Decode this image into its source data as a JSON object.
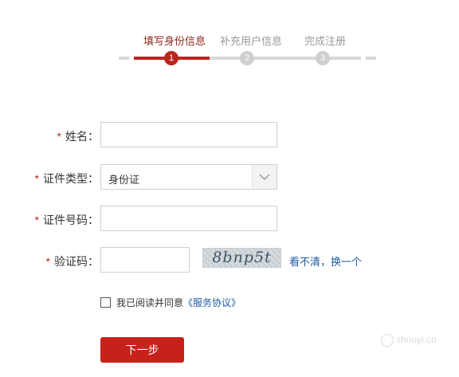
{
  "steps": [
    {
      "label": "填写身份信息",
      "number": "1",
      "active": true
    },
    {
      "label": "补充用户信息",
      "number": "2",
      "active": false
    },
    {
      "label": "完成注册",
      "number": "3",
      "active": false
    }
  ],
  "form": {
    "required_mark": "*",
    "name": {
      "label": "姓名：",
      "value": ""
    },
    "id_type": {
      "label": "证件类型：",
      "value": "身份证"
    },
    "id_number": {
      "label": "证件号码：",
      "value": ""
    },
    "captcha": {
      "label": "验证码：",
      "value": "",
      "image_text": "8bnp5t",
      "refresh_link": "看不清，换一个"
    }
  },
  "agreement": {
    "prefix": "我已阅读并同意",
    "link": "《服务协议》",
    "checked": false
  },
  "next_button": "下一步",
  "watermark": "shouyi.cn",
  "colors": {
    "accent": "#c5221a",
    "link": "#1d5a9e",
    "inactive_step": "#d8d8d8"
  }
}
